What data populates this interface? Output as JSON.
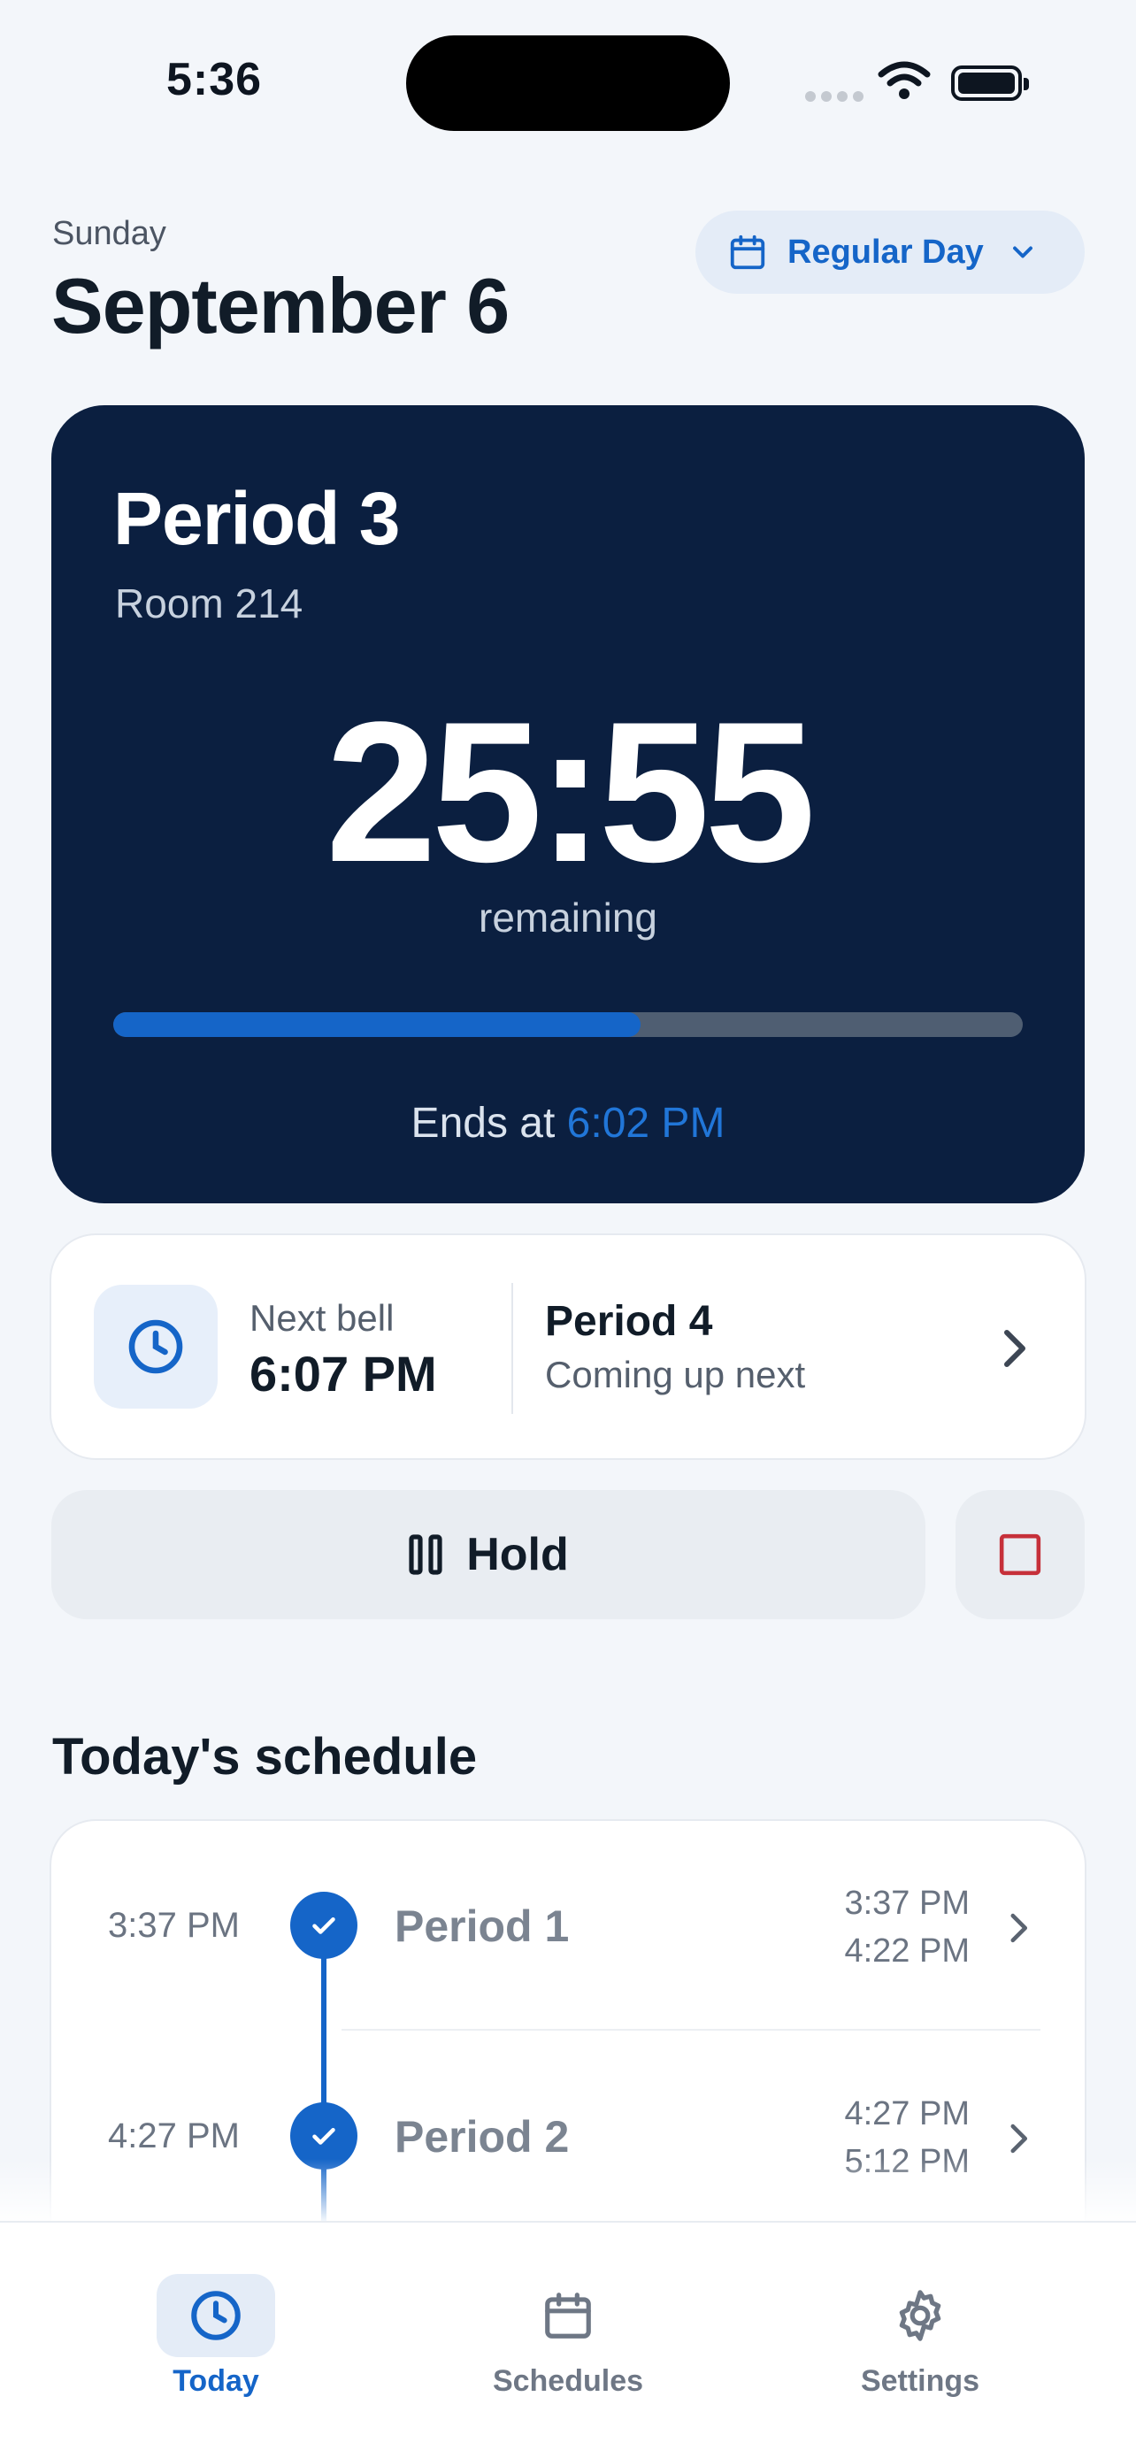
{
  "status_bar": {
    "time": "5:36"
  },
  "header": {
    "weekday": "Sunday",
    "date": "September 6",
    "day_type": "Regular Day"
  },
  "current": {
    "title": "Period 3",
    "room": "Room 214",
    "countdown": "25:55",
    "remaining_label": "remaining",
    "progress_fraction": 0.58,
    "ends_prefix": "Ends at",
    "ends_time": "6:02 PM"
  },
  "next_bell": {
    "label": "Next bell",
    "time": "6:07 PM",
    "period": "Period 4",
    "subtitle": "Coming up next"
  },
  "controls": {
    "hold_label": "Hold"
  },
  "schedule": {
    "title": "Today's schedule",
    "rows": [
      {
        "time": "3:37 PM",
        "name": "Period 1",
        "start": "3:37 PM",
        "end": "4:22 PM"
      },
      {
        "time": "4:27 PM",
        "name": "Period 2",
        "start": "4:27 PM",
        "end": "5:12 PM"
      }
    ]
  },
  "tabs": [
    {
      "label": "Today",
      "icon": "clock-icon",
      "active": true
    },
    {
      "label": "Schedules",
      "icon": "calendar-icon",
      "active": false
    },
    {
      "label": "Settings",
      "icon": "gear-icon",
      "active": false
    }
  ],
  "colors": {
    "accent": "#1565c8",
    "card_dark": "#0b1f40",
    "background": "#f3f6fa",
    "stop_red": "#c6303a"
  }
}
